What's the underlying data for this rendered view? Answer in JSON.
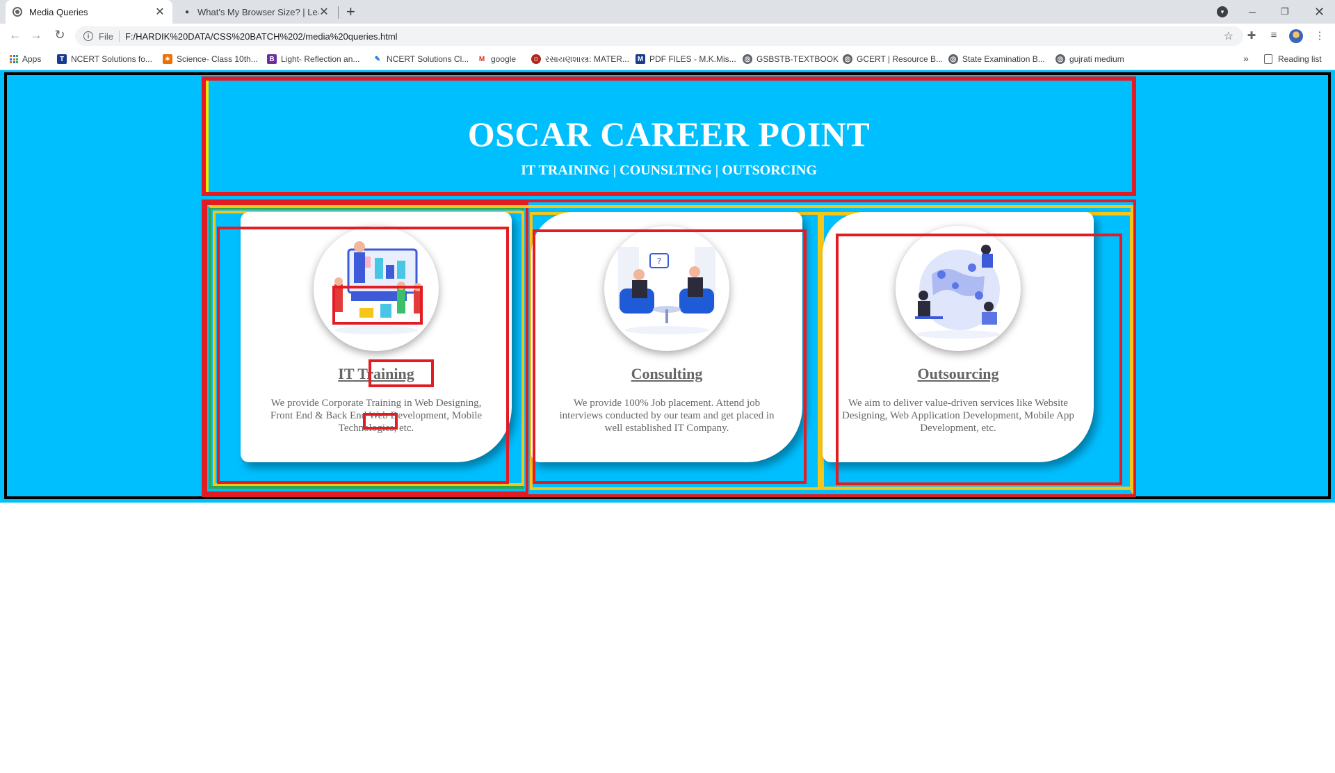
{
  "browser": {
    "tabs": [
      {
        "title": "Media Queries",
        "active": true
      },
      {
        "title": "What's My Browser Size? | Learn",
        "active": false
      }
    ],
    "new_tab": "+",
    "address": {
      "file_label": "File",
      "url": "F:/HARDIK%20DATA/CSS%20BATCH%202/media%20queries.html"
    },
    "bookmarks": [
      {
        "label": "Apps",
        "icon": "apps-grid-icon"
      },
      {
        "label": "NCERT Solutions fo...",
        "icon": "ncert-icon",
        "color": "#1a3c8f"
      },
      {
        "label": "Science- Class 10th...",
        "icon": "fox-icon",
        "color": "#e8710a"
      },
      {
        "label": "Light- Reflection an...",
        "icon": "b-icon",
        "color": "#6b2fa0"
      },
      {
        "label": "NCERT Solutions Cl...",
        "icon": "pen-icon",
        "color": "#1a73e8"
      },
      {
        "label": "google",
        "icon": "gmail-icon",
        "color": "#d93025"
      },
      {
        "label": "રસાયણશાસ્ત્ર: MATER...",
        "icon": "person-icon",
        "color": "#b3261e"
      },
      {
        "label": "PDF FILES - M.K.Mis...",
        "icon": "mk-icon",
        "color": "#1a3c8f"
      },
      {
        "label": "GSBSTB-TEXTBOOK",
        "icon": "globe-icon",
        "color": "#5f6368"
      },
      {
        "label": "GCERT | Resource B...",
        "icon": "globe-icon",
        "color": "#5f6368"
      },
      {
        "label": "State Examination B...",
        "icon": "globe-icon",
        "color": "#5f6368"
      },
      {
        "label": "gujrati medium",
        "icon": "globe-icon",
        "color": "#5f6368"
      }
    ],
    "bookmarks_more": "»",
    "reading_list": "Reading list"
  },
  "page": {
    "title": "OSCAR CAREER POINT",
    "subtitle": "IT TRAINING | COUNSLTING | OUTSORCING",
    "cards": [
      {
        "title": "IT Training",
        "text": "We provide Corporate Training in Web Designing, Front End & Back End Web Development, Mobile Technologies, etc.",
        "image": "training-illustration"
      },
      {
        "title": "Consulting",
        "text": "We provide 100% Job placement. Attend job interviews conducted by our team and get placed in well established IT Company.",
        "image": "consulting-illustration"
      },
      {
        "title": "Outsourcing",
        "text": "We aim to deliver value-driven services like Website Designing, Web Application Development, Mobile App Development, etc.",
        "image": "outsourcing-illustration"
      }
    ]
  },
  "colors": {
    "page_bg": "#00bfff",
    "outline_red": "#e31b23",
    "outline_yellow": "#f5c518",
    "outline_green": "#2ea84b",
    "card_text": "#666666"
  }
}
